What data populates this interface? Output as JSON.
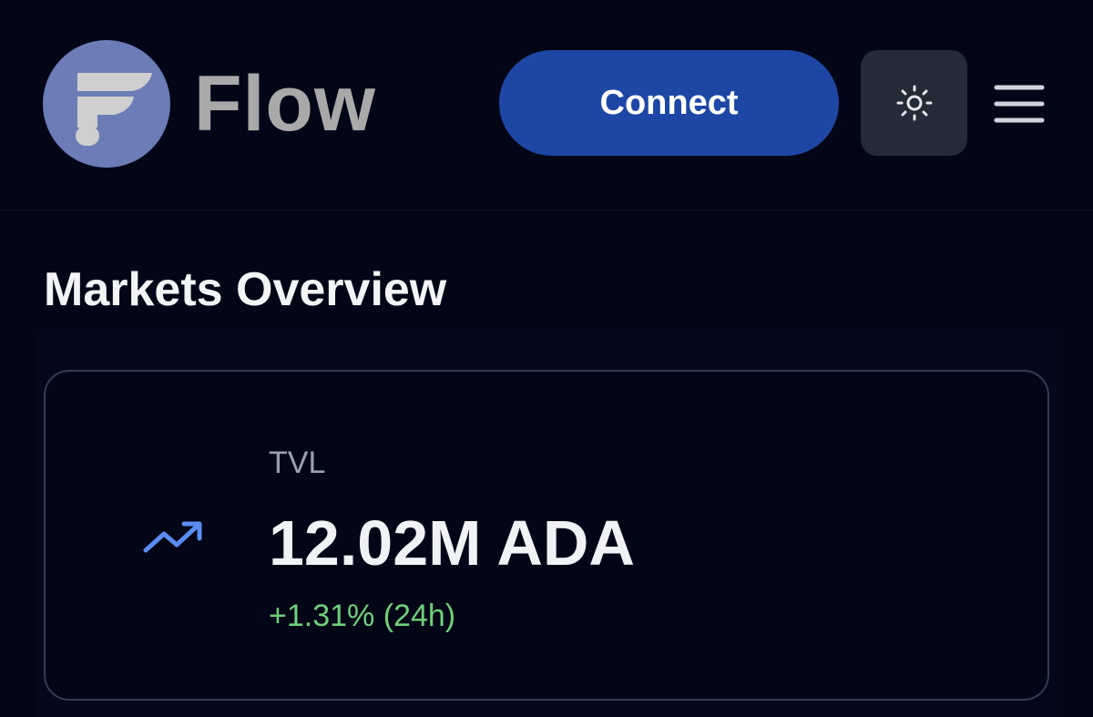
{
  "header": {
    "brand_name": "Flow",
    "connect_label": "Connect",
    "theme_icon": "sun-icon",
    "menu_icon": "hamburger-menu-icon",
    "colors": {
      "background": "#030617",
      "logo_circle": "#6b7cb6",
      "connect_button": "#1e47a5",
      "theme_button": "#232a38"
    }
  },
  "main": {
    "section_title": "Markets Overview",
    "tvl_card": {
      "icon": "trending-up-icon",
      "label": "TVL",
      "value": "12.02M ADA",
      "change": "+1.31% (24h)",
      "colors": {
        "icon": "#5b8cf0",
        "change": "#6fcf7a"
      }
    }
  }
}
